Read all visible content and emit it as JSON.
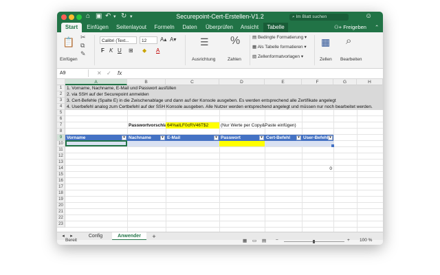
{
  "window": {
    "title": "Securepoint-Cert-Erstellen-V1.2",
    "search_placeholder": "Im Blatt suchen"
  },
  "ribbon_tabs": [
    "Start",
    "Einfügen",
    "Seitenlayout",
    "Formeln",
    "Daten",
    "Überprüfen",
    "Ansicht",
    "Tabelle"
  ],
  "share_label": "Freigeben",
  "ribbon": {
    "paste_label": "Einfügen",
    "font_name": "Calibri (Text...",
    "font_size": "12",
    "alignment_label": "Ausrichtung",
    "number_label": "Zahlen",
    "conditional_formatting": "Bedingte Formatierung",
    "format_as_table": "Als Tabelle formatieren",
    "cell_styles": "Zellenformatvorlagen",
    "cells_label": "Zellen",
    "editing_label": "Bearbeiten"
  },
  "formula_bar": {
    "name_box": "A9",
    "fx": "fx",
    "value": ""
  },
  "grid": {
    "columns": [
      "A",
      "B",
      "C",
      "D",
      "E",
      "F",
      "G",
      "H"
    ],
    "rows": [
      "1",
      "2",
      "3",
      "4",
      "5",
      "6",
      "7",
      "8",
      "9",
      "10",
      "11",
      "12",
      "13",
      "14",
      "15",
      "16",
      "17",
      "18",
      "19",
      "20",
      "21",
      "22",
      "23"
    ],
    "instructions": [
      "1. Vorname, Nachname, E-Mail und Passwort ausfüllen",
      "2. via SSH auf der Securepoint anmelden",
      "3.  Cert-Befehle (Spalte E) in die Zwischenablage und dann auf der Konsole ausgeben. Es werden entsprechend alle Zertifikate angelegt",
      "4. Userbefehl analog zum Certbefehl auf der SSH Konsole ausgeben. Alle Nutzer werden entsprechend angelegt und müssen nur noch bearbeitet werden."
    ],
    "password_label": "Passwortvorschlag",
    "password_value": "64%aILF0cRV46T$2",
    "password_note": "(Nur Werte per Copy&Paste einfügen)",
    "table_headers": [
      "Vorname",
      "Nachname",
      "E-Mail",
      "Passwort",
      "Cert-Befehl",
      "User-Befehl"
    ],
    "f13_value": "0"
  },
  "sheets": {
    "tabs": [
      "Config",
      "Anwender"
    ],
    "active": "Anwender",
    "add": "+"
  },
  "status": {
    "ready": "Bereit",
    "zoom": "100 %"
  },
  "colors": {
    "excel_green": "#217346",
    "table_header": "#4472c4",
    "table_row": "#d9e1f2",
    "password_highlight": "#ffff00"
  }
}
